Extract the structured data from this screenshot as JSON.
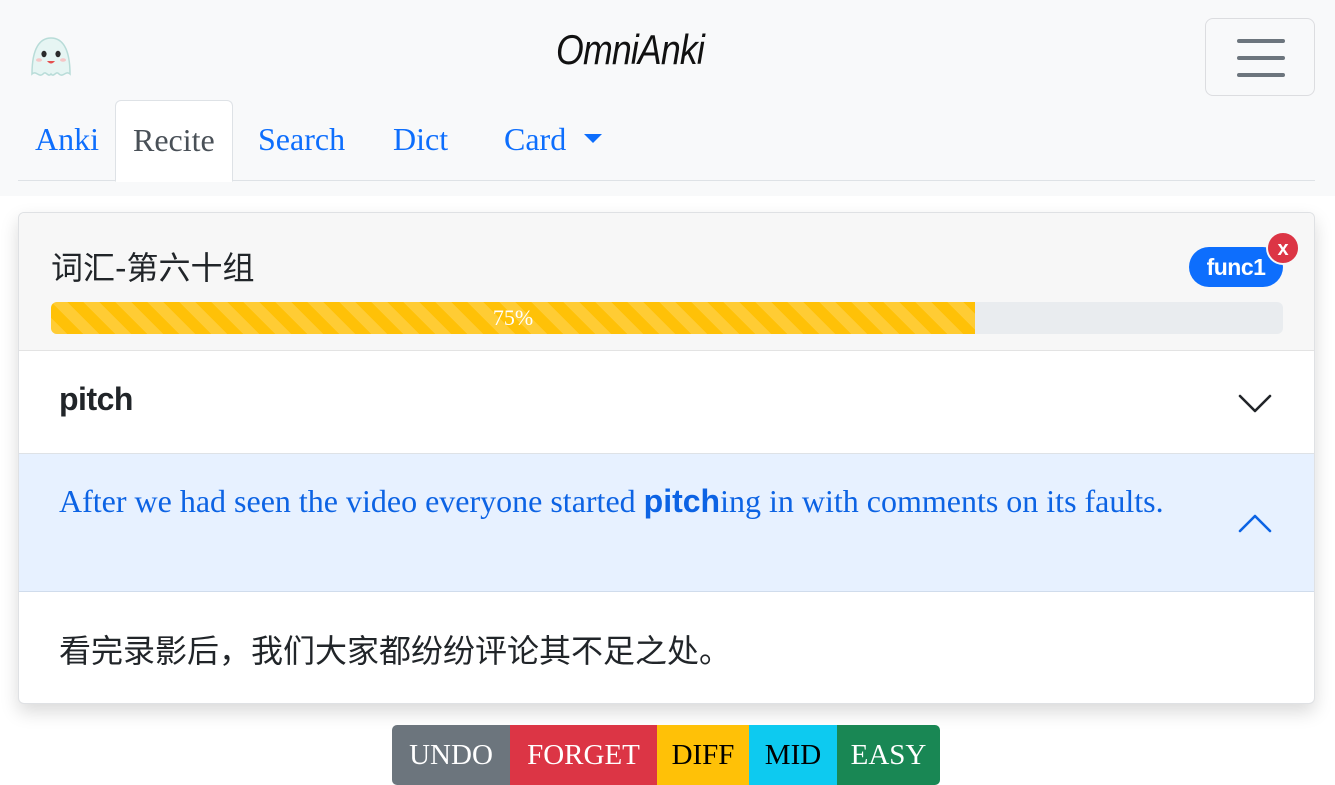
{
  "header": {
    "app_title": "OmniAnki",
    "logo_icon": "ghost-logo-icon",
    "menu_icon": "hamburger-menu-icon"
  },
  "nav": {
    "tabs": [
      {
        "label": "Anki",
        "active": false
      },
      {
        "label": "Recite",
        "active": true
      },
      {
        "label": "Search",
        "active": false
      },
      {
        "label": "Dict",
        "active": false
      },
      {
        "label": "Card",
        "active": false,
        "dropdown": true
      }
    ]
  },
  "card": {
    "group_title": "词汇-第六十组",
    "func_badge": "func1",
    "close_badge": "x",
    "progress": {
      "value": 0.75,
      "label": "75%",
      "color": "#ffc107"
    },
    "word": "pitch",
    "sentence": {
      "before": "After we had seen the video everyone started ",
      "highlight": "pitch",
      "after": "ing in with comments on its faults."
    },
    "translation": "看完录影后，我们大家都纷纷评论其不足之处。"
  },
  "actions": {
    "undo": "UNDO",
    "forget": "FORGET",
    "diff": "DIFF",
    "mid": "MID",
    "easy": "EASY"
  },
  "colors": {
    "primary": "#0d6efd",
    "danger": "#dc3545",
    "warning": "#ffc107",
    "info": "#0dcaf0",
    "success": "#198754",
    "secondary": "#6c757d"
  }
}
